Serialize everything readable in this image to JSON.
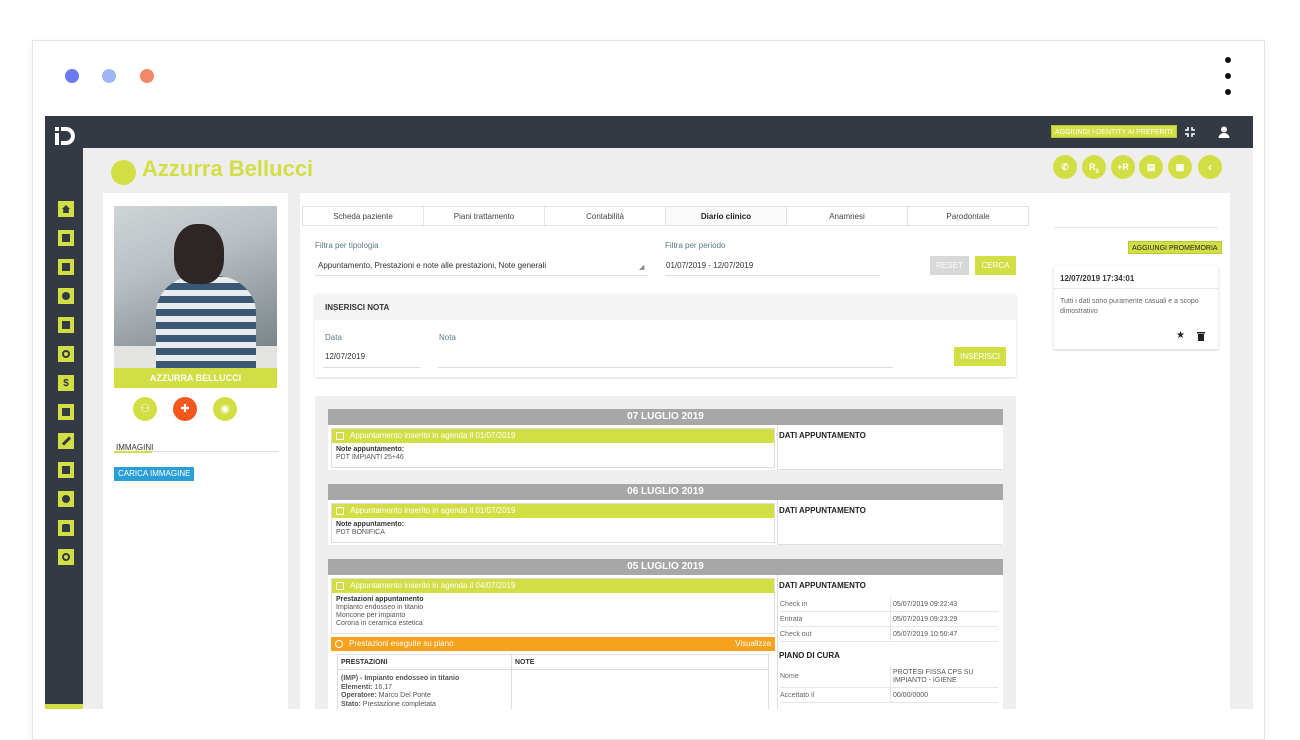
{
  "window": {
    "dot_colors": [
      "#6c7af0",
      "#9fb8f5",
      "#f5876a"
    ]
  },
  "topbar": {
    "favorites_label": "AGGIUNGI I-DENTITY AI PREFERITI",
    "icons": [
      "compress-icon",
      "user-icon"
    ]
  },
  "sidebar": {
    "items": [
      "home-icon",
      "calendar-icon",
      "patient-card-icon",
      "user-circle-icon",
      "chart-icon",
      "refresh-icon",
      "dollar-icon",
      "report-icon",
      "wrench-icon",
      "inbox-icon",
      "gear-icon",
      "lock-icon",
      "target-icon"
    ],
    "phone_icon": "phone-icon"
  },
  "patient": {
    "name": "Azzurra Bellucci",
    "photo_label": "AZZURRA BELLUCCI",
    "actions": [
      "whatsapp-icon",
      "R0",
      "+R",
      "print-icon",
      "grid-icon",
      "back-icon"
    ]
  },
  "left": {
    "immagini_label": "IMMAGINI",
    "carica_label": "CARICA IMMAGINE"
  },
  "tabs": [
    "Scheda paziente",
    "Piani trattamento",
    "Contabilità",
    "Diario clinico",
    "Anamnesi",
    "Parodontale"
  ],
  "filters": {
    "tipologia_label": "Filtra per tipologia",
    "tipologia_value": "Appuntamento, Prestazioni e note alle prestazioni, Note generali",
    "periodo_label": "Filtra per periodo",
    "periodo_value": "01/07/2019 - 12/07/2019",
    "reset_label": "RESET",
    "cerca_label": "CERCA"
  },
  "nota": {
    "title": "INSERISCI NOTA",
    "data_label": "Data",
    "data_value": "12/07/2019",
    "nota_label": "Nota",
    "inserisci_label": "INSERISCI"
  },
  "diary": [
    {
      "date": "07 LUGLIO 2019",
      "event": "Appuntamento inserito in agenda il 01/07/2019",
      "note_label": "Note appuntamento:",
      "note_value": "PDT IMPIANTI 25+46",
      "dati_label": "DATI APPUNTAMENTO"
    },
    {
      "date": "06 LUGLIO 2019",
      "event": "Appuntamento inserito in agenda il 01/07/2019",
      "note_label": "Note appuntamento:",
      "note_value": "PDT BONIFICA",
      "dati_label": "DATI APPUNTAMENTO"
    },
    {
      "date": "05 LUGLIO 2019",
      "event": "Appuntamento inserito in agenda il 04/07/2019",
      "prest_label": "Prestazioni appuntamento",
      "prest_items": [
        "Impianto endosseo in titanio",
        "Moncone per impianto",
        "Corona in ceramica estetica"
      ],
      "eseguite_label": "Prestazioni eseguite su piano",
      "visualizza_label": "Visualizza",
      "table_headers": [
        "PRESTAZIONI",
        "NOTE"
      ],
      "table_row": {
        "title": "(IMP) - Impianto endosseo in titanio",
        "elementi_label": "Elementi:",
        "elementi_value": "16,17",
        "operatore_label": "Operatore:",
        "operatore_value": "Marco Del Ponte",
        "stato_label": "Stato:",
        "stato_value": "Prestazione completata"
      },
      "dati_label": "DATI APPUNTAMENTO",
      "dati_rows": [
        {
          "k": "Check in",
          "v": "05/07/2019 09:22:43"
        },
        {
          "k": "Entrata",
          "v": "05/07/2019 09:23:29"
        },
        {
          "k": "Check out",
          "v": "05/07/2019 10:50:47"
        }
      ],
      "piano_label": "PIANO DI CURA",
      "piano_rows": [
        {
          "k": "Nome",
          "v": "PROTESI FISSA CPS SU IMPIANTO - IGIENE"
        },
        {
          "k": "Accettato il",
          "v": "00/00/0000"
        }
      ]
    }
  ],
  "right": {
    "promemoria_label": "AGGIUNGI PROMEMORIA",
    "card_date": "12/07/2019 17:34:01",
    "card_text": "Tutti i dati sono puramente casuali e a scopo dimostrativo",
    "card_icons": [
      "star-icon",
      "trash-icon"
    ]
  }
}
